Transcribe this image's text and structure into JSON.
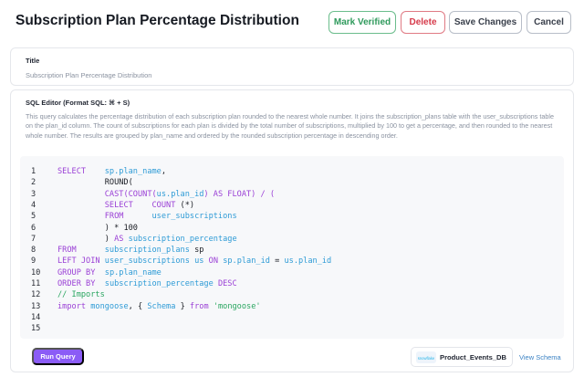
{
  "header": {
    "title": "Subscription Plan Percentage Distribution",
    "buttons": {
      "mark_verified": "Mark Verified",
      "delete": "Delete",
      "save_changes": "Save Changes",
      "cancel": "Cancel"
    }
  },
  "title_section": {
    "label": "Title",
    "value": "Subscription Plan Percentage Distribution"
  },
  "sql_section": {
    "label": "SQL Editor (Format SQL: ⌘ + S)",
    "description": "This query calculates the percentage distribution of each subscription plan rounded to the nearest whole number. It joins the subscription_plans table with the user_subscriptions table on the plan_id column. The count of subscriptions for each plan is divided by the total number of subscriptions, multiplied by 100 to get a percentage, and then rounded to the nearest whole number. The results are grouped by plan_name and ordered by the rounded subscription percentage in descending order."
  },
  "code_lines": [
    {
      "n": "1",
      "tokens": [
        [
          "kw",
          "SELECT"
        ],
        [
          "t",
          "    "
        ],
        [
          "id",
          "sp.plan_name"
        ],
        [
          "t",
          ","
        ]
      ]
    },
    {
      "n": "2",
      "tokens": [
        [
          "t",
          "          ROUND("
        ]
      ]
    },
    {
      "n": "3",
      "tokens": [
        [
          "t",
          "          "
        ],
        [
          "kw",
          "CAST("
        ],
        [
          "kw",
          "COUNT("
        ],
        [
          "id",
          "us.plan_id"
        ],
        [
          "kw",
          ") AS FLOAT) / ("
        ]
      ]
    },
    {
      "n": "4",
      "tokens": [
        [
          "t",
          "          "
        ],
        [
          "kw",
          "SELECT"
        ],
        [
          "t",
          "    "
        ],
        [
          "kw",
          "COUNT"
        ],
        [
          "t",
          " (*)"
        ]
      ]
    },
    {
      "n": "5",
      "tokens": [
        [
          "t",
          "          "
        ],
        [
          "kw",
          "FROM"
        ],
        [
          "t",
          "      "
        ],
        [
          "id",
          "user_subscriptions"
        ]
      ]
    },
    {
      "n": "6",
      "tokens": [
        [
          "t",
          "          ) * "
        ],
        [
          "num",
          "100"
        ]
      ]
    },
    {
      "n": "7",
      "tokens": [
        [
          "t",
          "          ) "
        ],
        [
          "kw",
          "AS"
        ],
        [
          "t",
          " "
        ],
        [
          "id",
          "subscription_percentage"
        ]
      ]
    },
    {
      "n": "8",
      "tokens": [
        [
          "kw",
          "FROM"
        ],
        [
          "t",
          "      "
        ],
        [
          "id",
          "subscription_plans"
        ],
        [
          "t",
          " sp"
        ]
      ]
    },
    {
      "n": "9",
      "tokens": [
        [
          "kw",
          "LEFT JOIN"
        ],
        [
          "t",
          " "
        ],
        [
          "id",
          "user_subscriptions"
        ],
        [
          "t",
          " "
        ],
        [
          "id",
          "us"
        ],
        [
          "t",
          " "
        ],
        [
          "kw",
          "ON"
        ],
        [
          "t",
          " "
        ],
        [
          "id",
          "sp.plan_id"
        ],
        [
          "t",
          " = "
        ],
        [
          "id",
          "us.plan_id"
        ]
      ]
    },
    {
      "n": "10",
      "tokens": [
        [
          "kw",
          "GROUP BY"
        ],
        [
          "t",
          "  "
        ],
        [
          "id",
          "sp.plan_name"
        ]
      ]
    },
    {
      "n": "11",
      "tokens": [
        [
          "kw",
          "ORDER BY"
        ],
        [
          "t",
          "  "
        ],
        [
          "id",
          "subscription_percentage"
        ],
        [
          "t",
          " "
        ],
        [
          "kw",
          "DESC"
        ]
      ]
    },
    {
      "n": "12",
      "tokens": [
        [
          "cm",
          "// Imports"
        ]
      ]
    },
    {
      "n": "13",
      "tokens": [
        [
          "kw",
          "import"
        ],
        [
          "t",
          " "
        ],
        [
          "id",
          "mongoose"
        ],
        [
          "t",
          ", { "
        ],
        [
          "id",
          "Schema"
        ],
        [
          "t",
          " } "
        ],
        [
          "kw",
          "from"
        ],
        [
          "t",
          " "
        ],
        [
          "str",
          "'mongoose'"
        ]
      ]
    },
    {
      "n": "14",
      "tokens": []
    },
    {
      "n": "15",
      "tokens": []
    }
  ],
  "footer": {
    "run_query": "Run Query",
    "database_name": "Product_Events_DB",
    "database_logo_text": "snowflake",
    "view_schema": "View Schema"
  }
}
